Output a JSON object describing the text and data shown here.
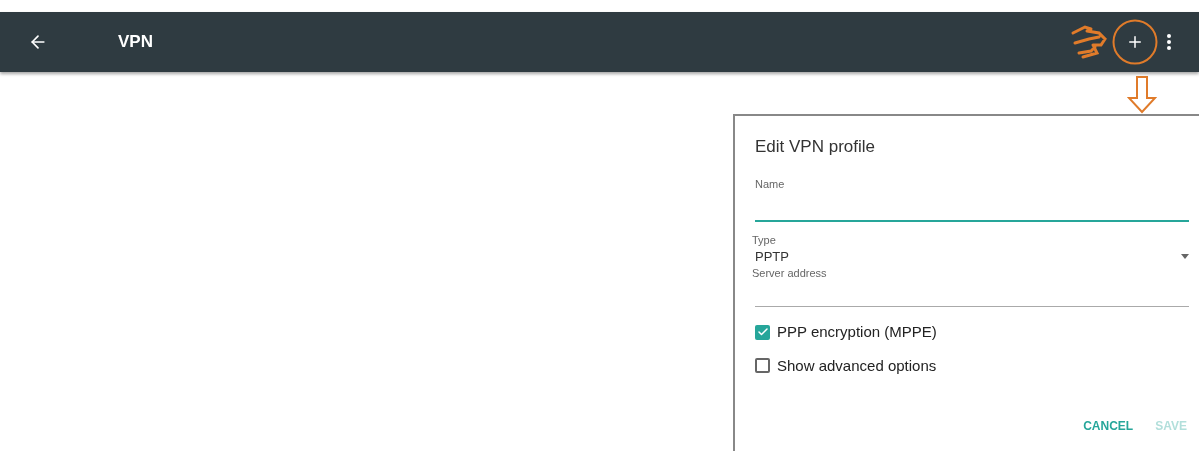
{
  "toolbar": {
    "title": "VPN"
  },
  "dialog": {
    "title": "Edit VPN profile",
    "name_field": {
      "label": "Name"
    },
    "type_field": {
      "label": "Type",
      "value": "PPTP"
    },
    "server_field": {
      "label": "Server address"
    },
    "options": [
      {
        "label": "PPP encryption (MPPE)",
        "checked": true
      },
      {
        "label": "Show advanced options",
        "checked": false
      }
    ],
    "buttons": [
      {
        "label": "CANCEL",
        "disabled": false
      },
      {
        "label": "SAVE",
        "disabled": true
      }
    ]
  }
}
